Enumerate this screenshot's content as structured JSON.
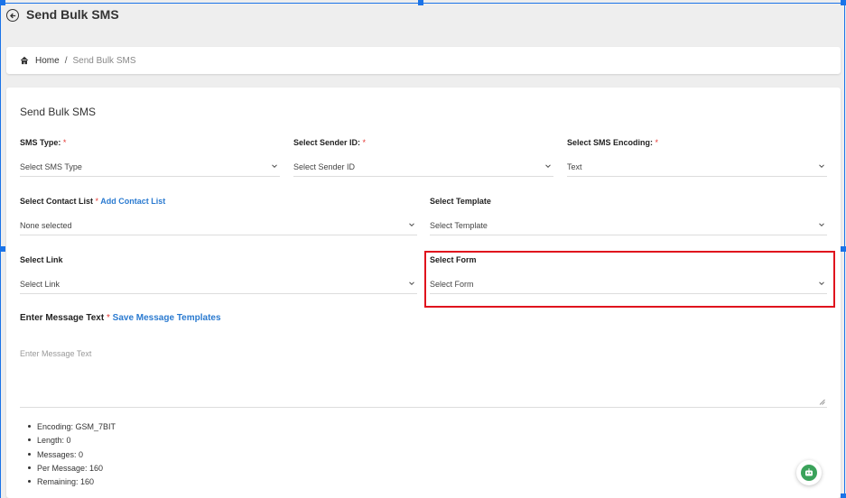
{
  "header": {
    "title": "Send Bulk SMS"
  },
  "breadcrumb": {
    "home": "Home",
    "separator": "/",
    "current": "Send Bulk SMS"
  },
  "form": {
    "card_title": "Send Bulk SMS",
    "required_mark": "*",
    "sms_type": {
      "label": "SMS Type:",
      "value": "Select SMS Type"
    },
    "sender_id": {
      "label": "Select Sender ID:",
      "value": "Select Sender ID"
    },
    "encoding": {
      "label": "Select SMS Encoding:",
      "value": "Text"
    },
    "contact_list": {
      "label": "Select Contact List",
      "link": "Add Contact List",
      "value": "None selected"
    },
    "template": {
      "label": "Select Template",
      "value": "Select Template"
    },
    "link": {
      "label": "Select Link",
      "value": "Select Link"
    },
    "form_select": {
      "label": "Select Form",
      "value": "Select Form"
    },
    "message": {
      "label": "Enter Message Text",
      "link": "Save Message Templates",
      "placeholder": "Enter Message Text"
    }
  },
  "stats": [
    "Encoding: GSM_7BIT",
    "Length: 0",
    "Messages: 0",
    "Per Message: 160",
    "Remaining: 160"
  ],
  "icons": {
    "back": "arrow-left-circle-icon",
    "home": "home-icon",
    "chevron": "chevron-down-icon",
    "chatbot": "robot-icon"
  },
  "colors": {
    "required": "#e53935",
    "link": "#2a7ad0",
    "highlight": "#e0121d",
    "chatbot": "#3aa25a",
    "selection": "#1a73e8"
  }
}
